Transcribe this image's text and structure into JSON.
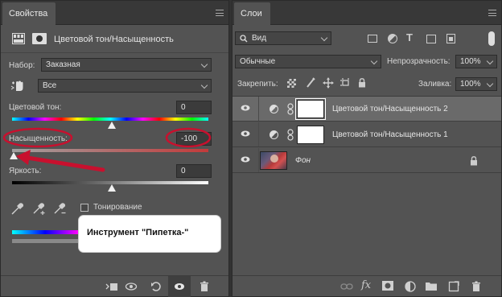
{
  "properties": {
    "tab_title": "Свойства",
    "header_title": "Цветовой тон/Насыщенность",
    "preset_label": "Набор:",
    "preset_value": "Заказная",
    "channel_value": "Все",
    "hue_label": "Цветовой тон:",
    "hue_value": "0",
    "saturation_label": "Насыщенность:",
    "saturation_value": "-100",
    "lightness_label": "Яркость:",
    "lightness_value": "0",
    "colorize_label": "Тонирование",
    "tooltip_text": "Инструмент \"Пипетка-\"",
    "slider_levels": {
      "hue": 0.5,
      "saturation": 0.0,
      "lightness": 0.5
    }
  },
  "layers": {
    "tab_title": "Слои",
    "filter_value": "Вид",
    "blend_mode": "Обычные",
    "opacity_label": "Непрозрачность:",
    "opacity_value": "100%",
    "lock_label": "Закрепить:",
    "fill_label": "Заливка:",
    "fill_value": "100%",
    "items": [
      {
        "name": "Цветовой тон/Насыщенность 2",
        "selected": true
      },
      {
        "name": "Цветовой тон/Насыщенность 1",
        "selected": false
      },
      {
        "name": "Фон",
        "selected": false
      }
    ]
  },
  "colors": {
    "panel_bg": "#535353",
    "annotation_red": "#c8102e",
    "selected_row": "#6a6a6a"
  }
}
